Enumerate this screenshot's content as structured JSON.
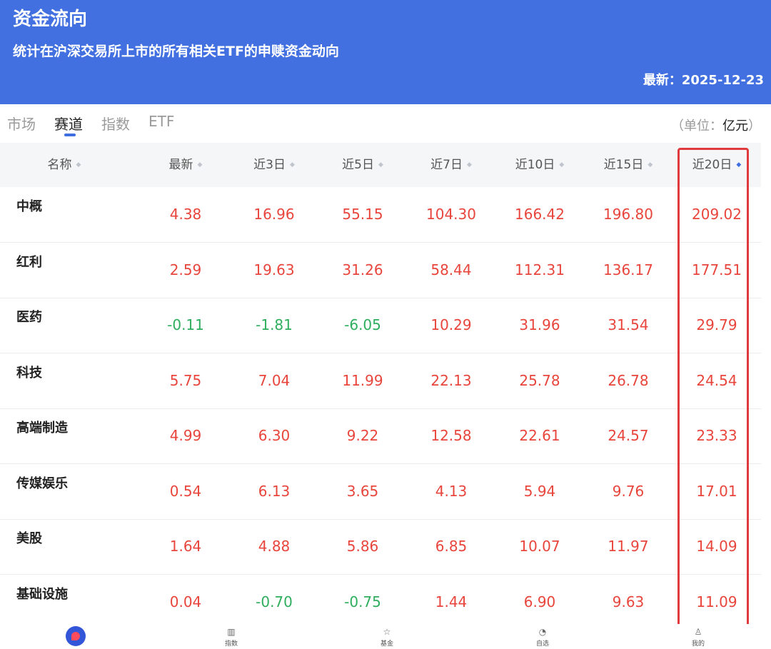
{
  "header": {
    "title": "资金流向",
    "subtitle": "统计在沪深交易所上市的所有相关ETF的申赎资金动向",
    "updated": "最新：2025-12-23"
  },
  "tabs": [
    {
      "label": "市场",
      "active": false
    },
    {
      "label": "赛道",
      "active": true
    },
    {
      "label": "指数",
      "active": false
    },
    {
      "label": "ETF",
      "active": false
    }
  ],
  "unit": {
    "prefix": "（单位：",
    "value": "亿元",
    "suffix": "）"
  },
  "columns": [
    "名称",
    "最新",
    "近3日",
    "近5日",
    "近7日",
    "近10日",
    "近15日",
    "近20日"
  ],
  "sort_icon": "◆",
  "rows": [
    {
      "name": "中概",
      "values": [
        "4.38",
        "16.96",
        "55.15",
        "104.30",
        "166.42",
        "196.80",
        "209.02"
      ]
    },
    {
      "name": "红利",
      "values": [
        "2.59",
        "19.63",
        "31.26",
        "58.44",
        "112.31",
        "136.17",
        "177.51"
      ]
    },
    {
      "name": "医药",
      "values": [
        "-0.11",
        "-1.81",
        "-6.05",
        "10.29",
        "31.96",
        "31.54",
        "29.79"
      ]
    },
    {
      "name": "科技",
      "values": [
        "5.75",
        "7.04",
        "11.99",
        "22.13",
        "25.78",
        "26.78",
        "24.54"
      ]
    },
    {
      "name": "高端制造",
      "values": [
        "4.99",
        "6.30",
        "9.22",
        "12.58",
        "22.61",
        "24.57",
        "23.33"
      ]
    },
    {
      "name": "传媒娱乐",
      "values": [
        "0.54",
        "6.13",
        "3.65",
        "4.13",
        "5.94",
        "9.76",
        "17.01"
      ]
    },
    {
      "name": "美股",
      "values": [
        "1.64",
        "4.88",
        "5.86",
        "6.85",
        "10.07",
        "11.97",
        "14.09"
      ]
    },
    {
      "name": "基础设施",
      "values": [
        "0.04",
        "-0.70",
        "-0.75",
        "1.44",
        "6.90",
        "9.63",
        "11.09"
      ]
    }
  ],
  "nav": [
    {
      "label": "",
      "icon": "home-logo-icon"
    },
    {
      "label": "指数",
      "icon": "index-icon"
    },
    {
      "label": "基金",
      "icon": "fund-icon"
    },
    {
      "label": "自选",
      "icon": "watchlist-icon"
    },
    {
      "label": "我的",
      "icon": "profile-icon"
    }
  ],
  "colors": {
    "header_bg": "#4270e0",
    "positive": "#e8453c",
    "negative": "#2fae5e",
    "highlight_border": "#e03a3e"
  }
}
